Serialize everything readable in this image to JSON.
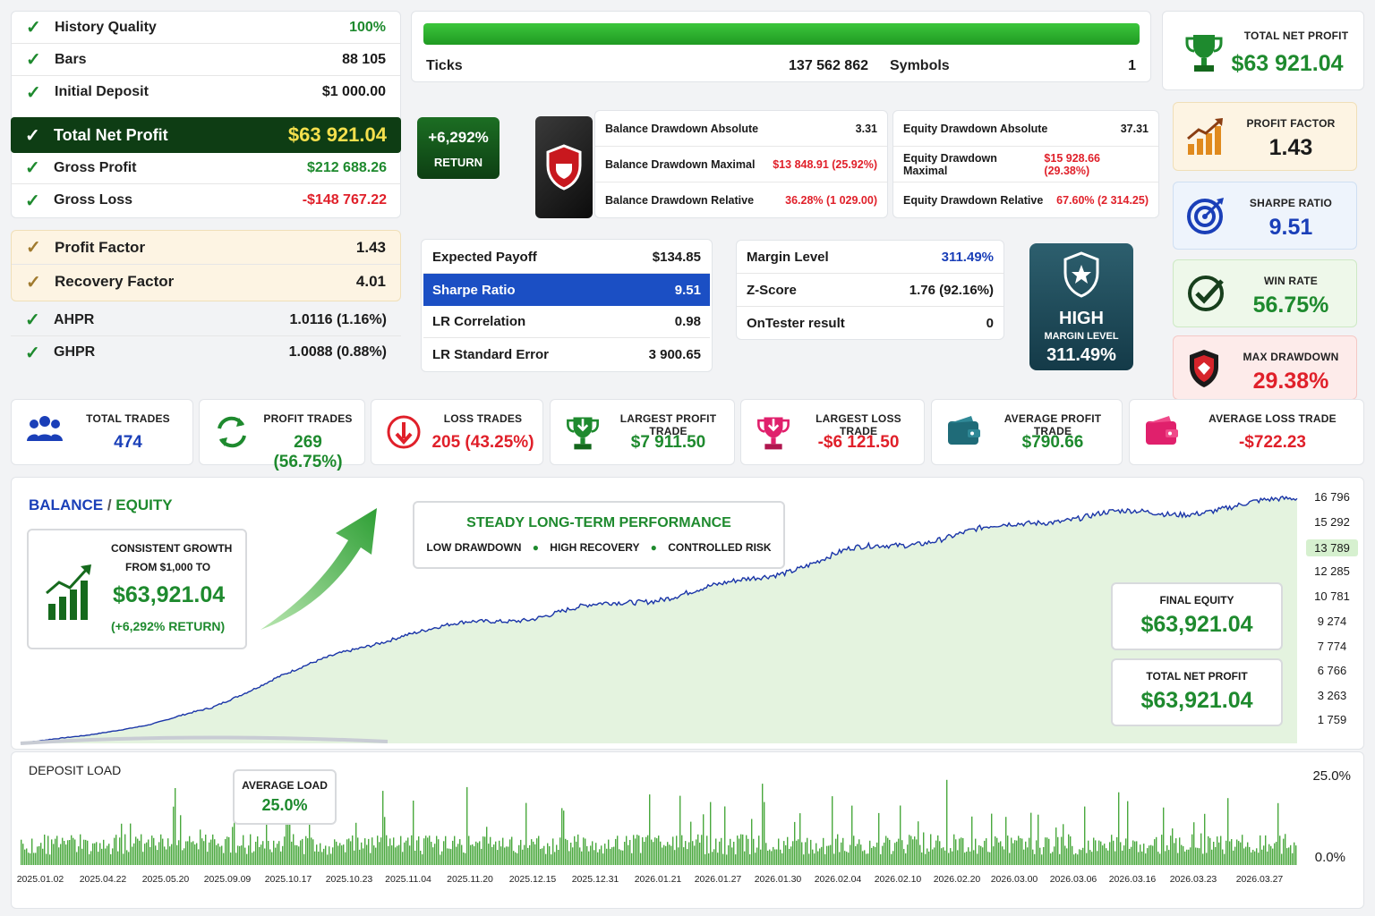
{
  "left_stats": {
    "top": [
      {
        "label": "History Quality",
        "value": "100%"
      },
      {
        "label": "Bars",
        "value": "88 105"
      },
      {
        "label": "Initial Deposit",
        "value": "$1 000.00"
      }
    ],
    "highlight": {
      "label": "Total Net Profit",
      "value": "$63 921.04"
    },
    "bottom": [
      {
        "label": "Gross Profit",
        "value": "$212 688.26"
      },
      {
        "label": "Gross Loss",
        "value": "-$148 767.22"
      }
    ],
    "factors": [
      {
        "label": "Profit Factor",
        "value": "1.43"
      },
      {
        "label": "Recovery Factor",
        "value": "4.01"
      }
    ],
    "hpr": [
      {
        "label": "AHPR",
        "value": "1.0116 (1.16%)"
      },
      {
        "label": "GHPR",
        "value": "1.0088 (0.88%)"
      }
    ]
  },
  "ticks": {
    "label": "Ticks",
    "value": "137 562 862",
    "symbols_label": "Symbols",
    "symbols_value": "1",
    "progress": 100
  },
  "return_badge": {
    "value": "+6,292%",
    "label": "RETURN"
  },
  "balance_dd": [
    {
      "label": "Balance Drawdown Absolute",
      "value": "3.31"
    },
    {
      "label": "Balance Drawdown Maximal",
      "value": "$13 848.91 (25.92%)"
    },
    {
      "label": "Balance Drawdown Relative",
      "value": "36.28% (1 029.00)"
    }
  ],
  "equity_dd": [
    {
      "label": "Equity Drawdown Absolute",
      "value": "37.31"
    },
    {
      "label": "Equity Drawdown Maximal",
      "value": "$15 928.66 (29.38%)"
    },
    {
      "label": "Equity Drawdown Relative",
      "value": "67.60% (2 314.25)"
    }
  ],
  "payoff": [
    {
      "label": "Expected Payoff",
      "value": "$134.85"
    },
    {
      "label": "Sharpe Ratio",
      "value": "9.51"
    },
    {
      "label": "LR Correlation",
      "value": "0.98"
    },
    {
      "label": "LR Standard Error",
      "value": "3 900.65"
    }
  ],
  "margin": [
    {
      "label": "Margin Level",
      "value": "311.49%"
    },
    {
      "label": "Z-Score",
      "value": "1.76 (92.16%)"
    },
    {
      "label": "OnTester result",
      "value": "0"
    }
  ],
  "margin_badge": {
    "title": "HIGH",
    "sub": "MARGIN LEVEL",
    "value": "311.49%"
  },
  "right_kpis": [
    {
      "title": "TOTAL NET PROFIT",
      "value": "$63 921.04"
    },
    {
      "title": "PROFIT FACTOR",
      "value": "1.43"
    },
    {
      "title": "SHARPE RATIO",
      "value": "9.51"
    },
    {
      "title": "WIN RATE",
      "value": "56.75%"
    },
    {
      "title": "MAX DRAWDOWN",
      "value": "29.38%"
    }
  ],
  "trades": [
    {
      "title": "TOTAL TRADES",
      "value": "474"
    },
    {
      "title": "PROFIT TRADES",
      "value": "269 (56.75%)"
    },
    {
      "title": "LOSS TRADES",
      "value": "205 (43.25%)"
    },
    {
      "title": "LARGEST PROFIT TRADE",
      "value": "$7 911.50"
    },
    {
      "title": "LARGEST LOSS TRADE",
      "value": "-$6 121.50"
    },
    {
      "title": "AVERAGE PROFIT TRADE",
      "value": "$790.66"
    },
    {
      "title": "AVERAGE LOSS TRADE",
      "value": "-$722.23"
    }
  ],
  "chart_header": {
    "balance": "BALANCE",
    "sep": " / ",
    "equity": "EQUITY"
  },
  "growth_box": {
    "line1": "CONSISTENT GROWTH",
    "line2": "FROM $1,000 TO",
    "value": "$63,921.04",
    "note": "(+6,292% RETURN)"
  },
  "perf_box": {
    "title": "STEADY LONG-TERM PERFORMANCE",
    "tags": [
      "LOW DRAWDOWN",
      "HIGH RECOVERY",
      "CONTROLLED RISK"
    ]
  },
  "final_boxes": [
    {
      "title": "FINAL EQUITY",
      "value": "$63,921.04"
    },
    {
      "title": "TOTAL NET PROFIT",
      "value": "$63,921.04"
    }
  ],
  "deposit": {
    "title": "DEPOSIT LOAD",
    "avg_label": "AVERAGE LOAD",
    "avg_value": "25.0%",
    "ymax": "25.0%",
    "ymin": "0.0%"
  },
  "colors": {
    "green": "#1e8a2e",
    "red": "#e0202a",
    "blue": "#1a3fb8",
    "dark_green": "#0e3d14"
  },
  "chart_data": [
    {
      "type": "line",
      "title": "BALANCE / EQUITY",
      "y_ticks": [
        "16 796",
        "15 292",
        "13 789",
        "12 285",
        "10 781",
        "9 274",
        "7 774",
        "6 766",
        "3 263",
        "1 759"
      ],
      "highlight_tick": "13 789",
      "ylim": [
        1000,
        17000
      ],
      "grid": false,
      "series": [],
      "trend": [
        [
          0,
          1000
        ],
        [
          0.05,
          1500
        ],
        [
          0.1,
          2200
        ],
        [
          0.15,
          3300
        ],
        [
          0.2,
          5300
        ],
        [
          0.25,
          6800
        ],
        [
          0.3,
          8100
        ],
        [
          0.35,
          8800
        ],
        [
          0.4,
          9200
        ],
        [
          0.45,
          9900
        ],
        [
          0.5,
          10500
        ],
        [
          0.55,
          11200
        ],
        [
          0.6,
          12300
        ],
        [
          0.65,
          13500
        ],
        [
          0.7,
          14100
        ],
        [
          0.75,
          14800
        ],
        [
          0.8,
          15500
        ],
        [
          0.85,
          15900
        ],
        [
          0.9,
          16000
        ],
        [
          0.95,
          16300
        ],
        [
          1,
          17000
        ]
      ]
    },
    {
      "type": "bar",
      "title": "DEPOSIT LOAD",
      "x_ticks": [
        "2025.01.02",
        "2025.04.22",
        "2025.05.20",
        "2025.09.09",
        "2025.10.17",
        "2025.10.23",
        "2025.11.04",
        "2025.11.20",
        "2025.12.15",
        "2025.12.31",
        "2026.01.21",
        "2026.01.27",
        "2026.01.30",
        "2026.02.04",
        "2026.02.10",
        "2026.02.20",
        "2026.03.00",
        "2026.03.06",
        "2026.03.16",
        "2026.03.23",
        "2026.03.27"
      ],
      "ylim": [
        0,
        25
      ]
    }
  ]
}
